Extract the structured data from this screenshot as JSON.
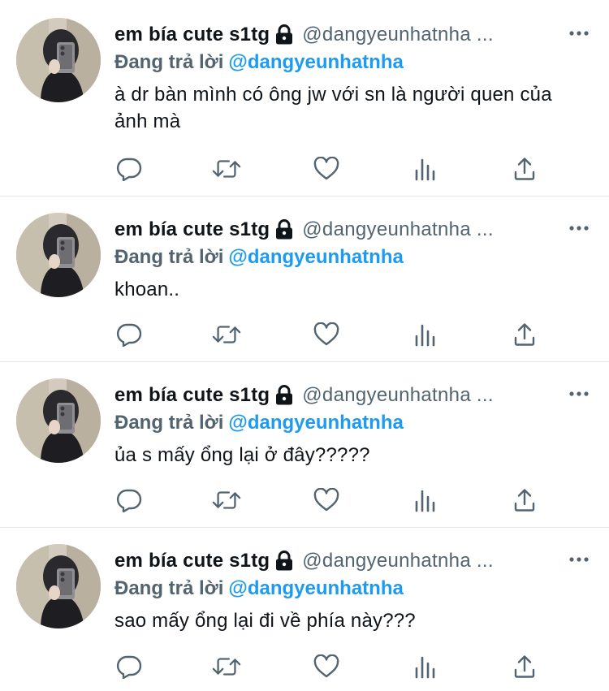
{
  "colors": {
    "text": "#0f1419",
    "secondary": "#536471",
    "accent": "#1d9bf0",
    "divider": "#e3e7ea"
  },
  "tweets": [
    {
      "name": "em bía cute s1tg",
      "handle": "@dangyeunhatnha ...",
      "replying_label": "Đang trả lời",
      "replying_to": "@dangyeunhatnha",
      "text": "à dr bàn mình có ông jw với sn là người quen của ảnh mà",
      "icons": [
        "reply-icon",
        "retweet-icon",
        "like-icon",
        "analytics-icon",
        "share-icon"
      ]
    },
    {
      "name": "em bía cute s1tg",
      "handle": "@dangyeunhatnha ...",
      "replying_label": "Đang trả lời",
      "replying_to": "@dangyeunhatnha",
      "text": "khoan..",
      "icons": [
        "reply-icon",
        "retweet-icon",
        "like-icon",
        "analytics-icon",
        "share-icon"
      ]
    },
    {
      "name": "em bía cute s1tg",
      "handle": "@dangyeunhatnha ...",
      "replying_label": "Đang trả lời",
      "replying_to": "@dangyeunhatnha",
      "text": "ủa s mấy ổng lại ở đây?????",
      "icons": [
        "reply-icon",
        "retweet-icon",
        "like-icon",
        "analytics-icon",
        "share-icon"
      ]
    },
    {
      "name": "em bía cute s1tg",
      "handle": "@dangyeunhatnha ...",
      "replying_label": "Đang trả lời",
      "replying_to": "@dangyeunhatnha",
      "text": "sao mấy ổng lại đi về phía này???",
      "icons": [
        "reply-icon",
        "retweet-icon",
        "like-icon",
        "analytics-icon",
        "share-icon"
      ]
    }
  ]
}
